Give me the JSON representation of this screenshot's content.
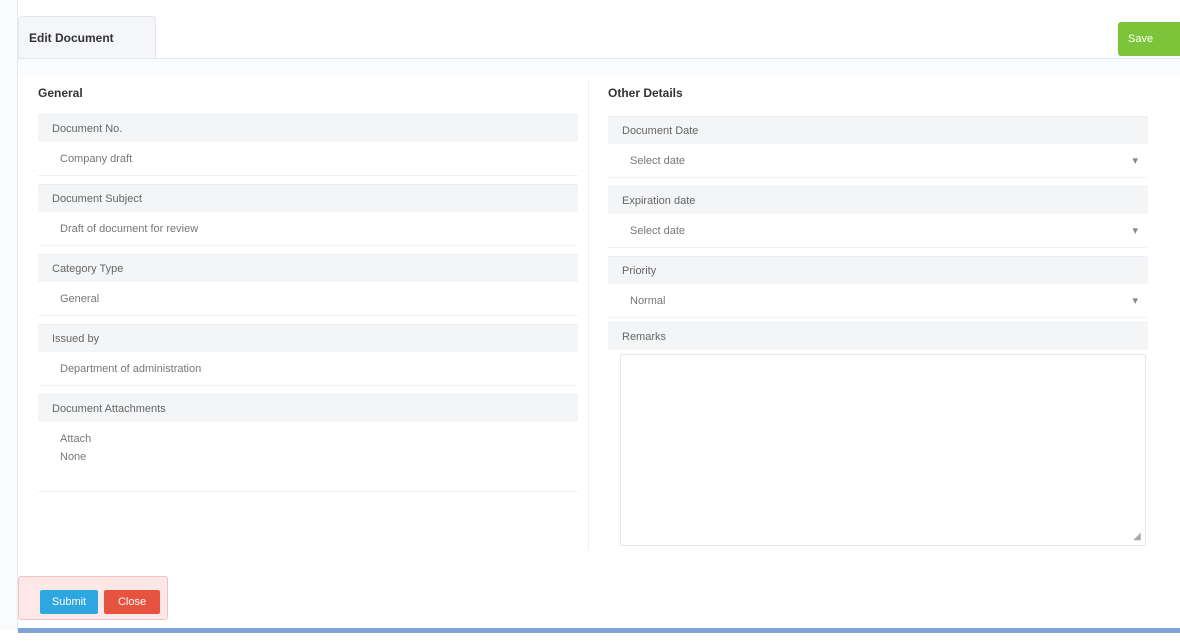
{
  "window": {
    "tab_title": "Edit Document",
    "top_right_button": "Save"
  },
  "left_panel": {
    "title": "General",
    "fields": [
      {
        "label": "Document No.",
        "value": "Company draft"
      },
      {
        "label": "Document Subject",
        "value": "Draft of document for review"
      },
      {
        "label": "Category Type",
        "value": "General"
      },
      {
        "label": "Issued by",
        "value": "Department of administration"
      },
      {
        "label": "Document Attachments",
        "value": "Attach\nNone"
      }
    ]
  },
  "right_panel": {
    "title": "Other Details",
    "fields": [
      {
        "label": "Document Date",
        "value": "Select date",
        "unit": "▾"
      },
      {
        "label": "Expiration date",
        "value": "Select date",
        "unit": "▾"
      },
      {
        "label": "Priority",
        "value": "Normal",
        "unit": "▾"
      }
    ],
    "notes_label": "Remarks",
    "notes_value": ""
  },
  "footer": {
    "save_label": "Submit",
    "cancel_label": "Close"
  },
  "colors": {
    "accent_green": "#7cc43a",
    "accent_blue": "#2ea7e0",
    "accent_red": "#e8533f",
    "bottom_border": "#7fa3d6"
  }
}
